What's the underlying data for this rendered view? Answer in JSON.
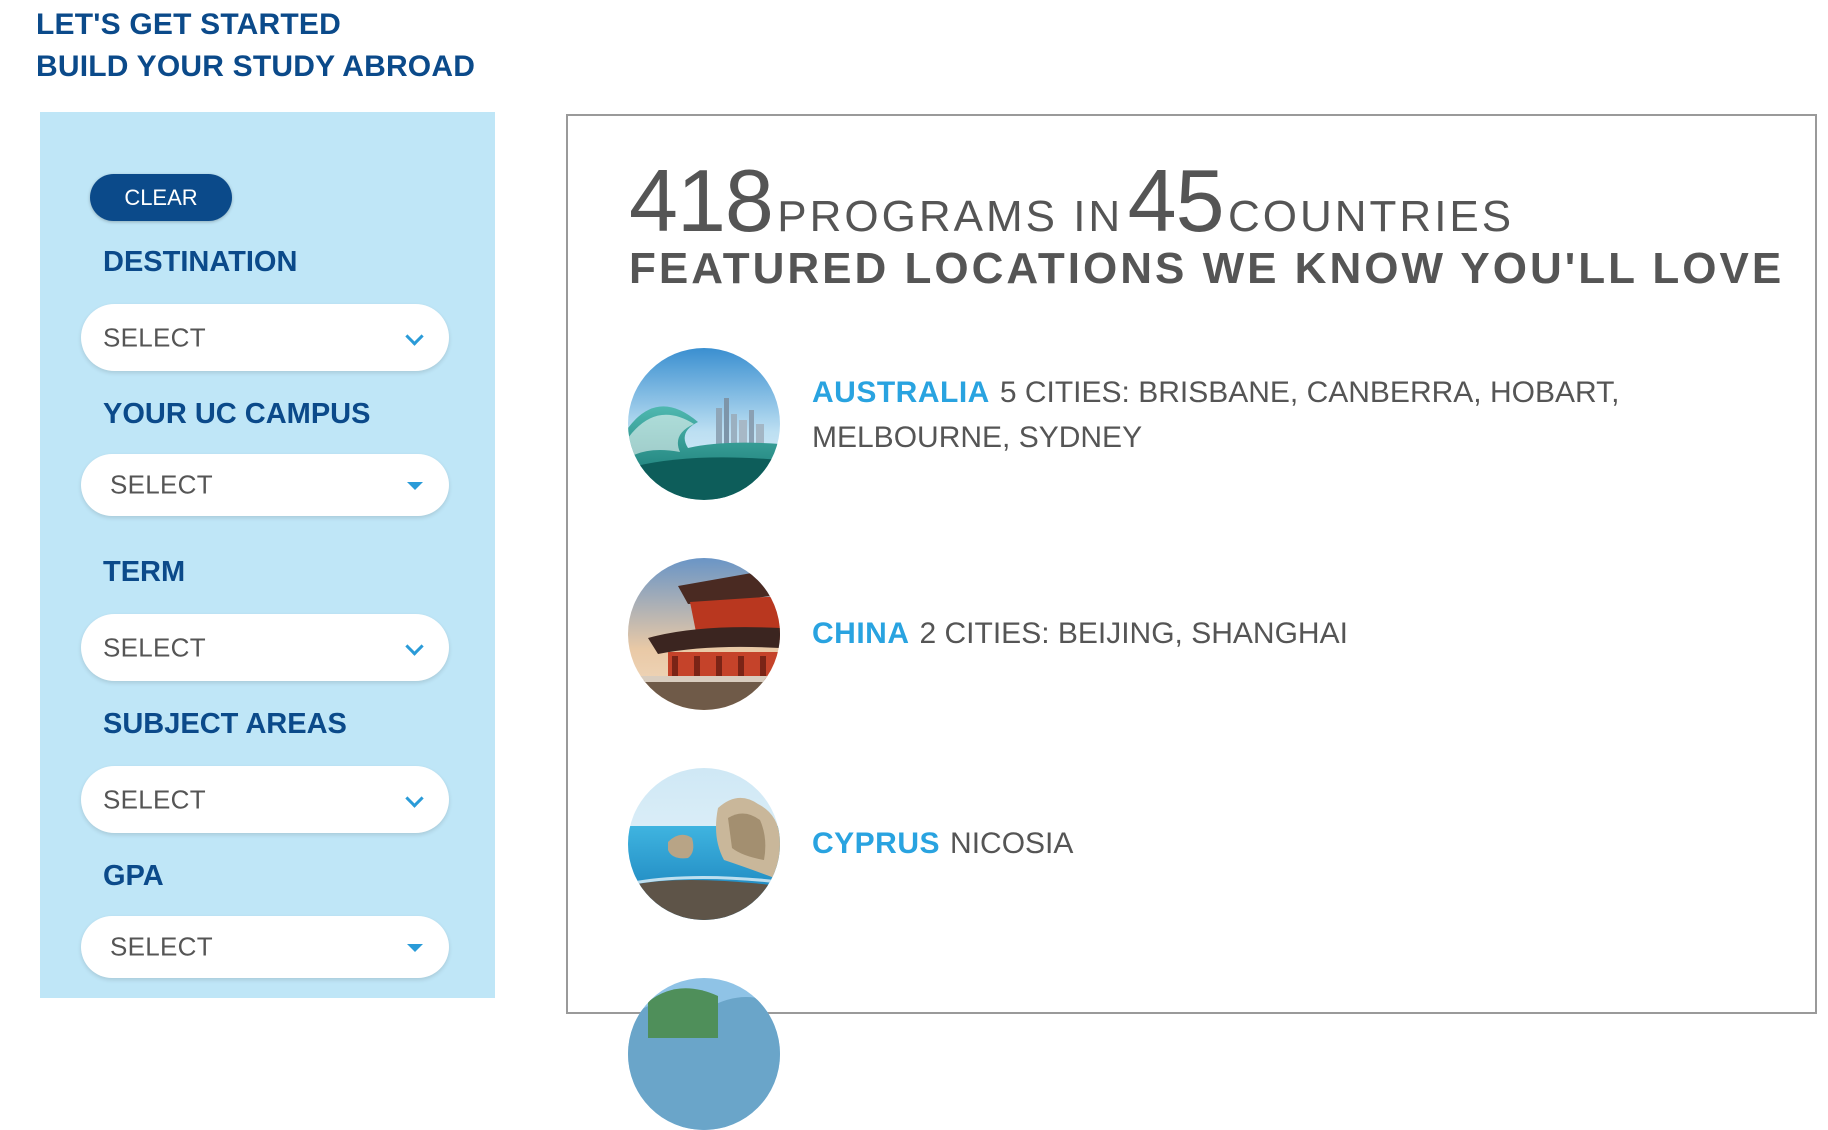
{
  "header": {
    "line1": "LET'S GET STARTED",
    "line2": "BUILD YOUR STUDY ABROAD"
  },
  "sidebar": {
    "clear_label": "CLEAR",
    "filters": [
      {
        "label": "DESTINATION",
        "value": "SELECT"
      },
      {
        "label": "YOUR UC CAMPUS",
        "value": "SELECT"
      },
      {
        "label": "TERM",
        "value": "SELECT"
      },
      {
        "label": "SUBJECT AREAS",
        "value": "SELECT"
      },
      {
        "label": "GPA",
        "value": "SELECT"
      }
    ]
  },
  "main": {
    "program_count": "418",
    "programs_label": "PROGRAMS IN",
    "country_count": "45",
    "countries_label": "COUNTRIES",
    "featured_heading": "FEATURED LOCATIONS WE KNOW YOU'LL LOVE",
    "locations": [
      {
        "country": "AUSTRALIA",
        "cities": "5 CITIES:  BRISBANE, CANBERRA, HOBART, MELBOURNE, SYDNEY"
      },
      {
        "country": "CHINA",
        "cities": "2 CITIES:  BEIJING, SHANGHAI"
      },
      {
        "country": "CYPRUS",
        "cities": "NICOSIA"
      }
    ]
  },
  "colors": {
    "brand_navy": "#0b4a8a",
    "sidebar_bg": "#bfe6f7",
    "country_blue": "#29a3e0",
    "text_gray": "#555555"
  }
}
